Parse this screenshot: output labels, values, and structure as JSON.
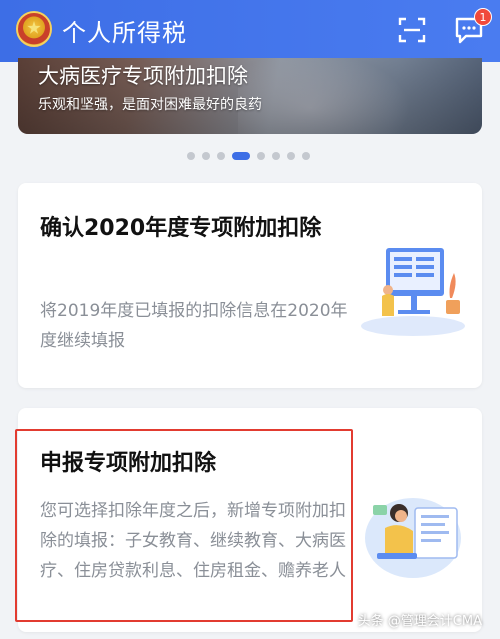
{
  "header": {
    "title": "个人所得税",
    "badge_count": "1"
  },
  "banner": {
    "title": "大病医疗专项附加扣除",
    "subtitle": "乐观和坚强，是面对困难最好的良药"
  },
  "carousel": {
    "total": 8,
    "active_index": 3
  },
  "cards": [
    {
      "title": "确认2020年度专项附加扣除",
      "description": "将2019年度已填报的扣除信息在2020年度继续填报"
    },
    {
      "title": "申报专项附加扣除",
      "description": "您可选择扣除年度之后，新增专项附加扣除的填报：子女教育、继续教育、大病医疗、住房贷款利息、住房租金、赡养老人"
    }
  ],
  "watermark": "头条 @管理会计CMA",
  "colors": {
    "header": "#3d6ee6",
    "highlight": "#e23b30",
    "badge": "#f0493c"
  }
}
